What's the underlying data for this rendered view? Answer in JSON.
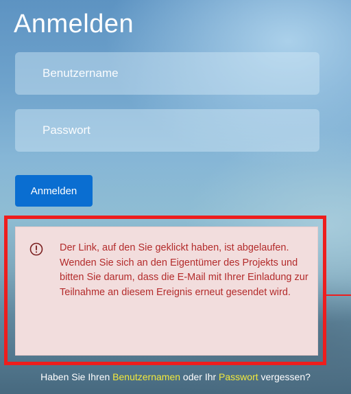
{
  "login": {
    "title": "Anmelden",
    "username_placeholder": "Benutzername",
    "password_placeholder": "Passwort",
    "submit_label": "Anmelden"
  },
  "alert": {
    "icon": "exclamation-circle-icon",
    "message": "Der Link, auf den Sie geklickt haben, ist abgelaufen. Wenden Sie sich an den Eigentümer des Projekts und bitten Sie darum, dass die E-Mail mit Ihrer Einladung zur Teilnahme an diesem Ereignis erneut gesendet wird."
  },
  "footer": {
    "prefix": "Haben Sie Ihren ",
    "username_link": "Benutzernamen",
    "middle": " oder Ihr ",
    "password_link": "Passwort",
    "suffix": " vergessen?"
  },
  "colors": {
    "button": "#0a6ed1",
    "alert_background": "#f2dddd",
    "alert_text": "#b32b2b",
    "highlight_border": "#ee1d1d",
    "footer_link": "#f3ea3c"
  }
}
